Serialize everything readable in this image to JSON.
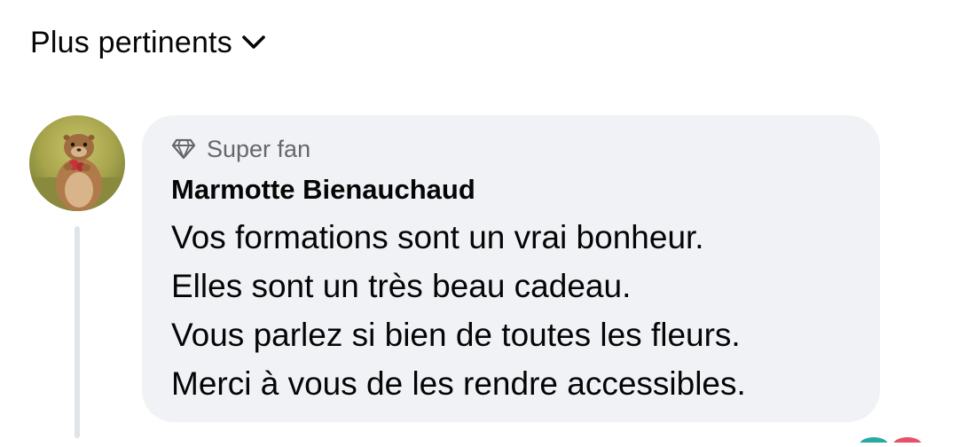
{
  "sort": {
    "label": "Plus pertinents",
    "icon": "chevron-down-icon"
  },
  "comment": {
    "avatar_icon": "marmot-avatar",
    "badge": {
      "icon": "diamond-icon",
      "label": "Super fan"
    },
    "author": "Marmotte Bienauchaud",
    "lines": [
      "Vos formations sont un vrai bonheur.",
      "Elles sont un très beau cadeau.",
      "Vous parlez si bien de toutes les fleurs.",
      "Merci à vous de les rendre accessibles."
    ]
  },
  "colors": {
    "bubble_background": "#f0f2f5",
    "secondary_text": "#65676b",
    "primary_text": "#050505",
    "thread_line": "#e0e3e8"
  }
}
